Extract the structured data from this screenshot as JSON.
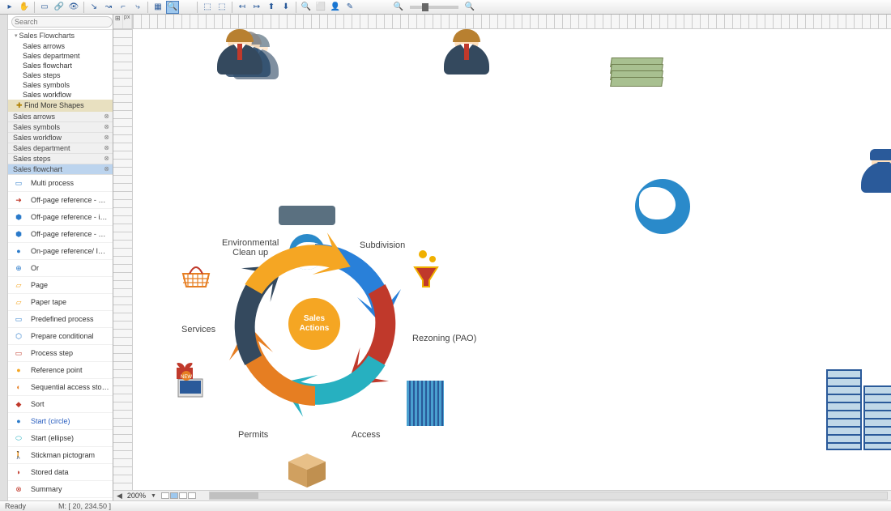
{
  "toolbar": {
    "search_placeholder": "Search"
  },
  "sidebar": {
    "tree_header": "Sales Flowcharts",
    "tree_items": [
      "Sales arrows",
      "Sales department",
      "Sales flowchart",
      "Sales steps",
      "Sales symbols",
      "Sales workflow"
    ],
    "find_more": "Find More Shapes",
    "libs": [
      "Sales arrows",
      "Sales symbols",
      "Sales workflow",
      "Sales department",
      "Sales steps",
      "Sales flowchart"
    ],
    "shapes": [
      {
        "label": "Multi process",
        "color": "#333"
      },
      {
        "label": "Off-page reference - arrow",
        "color": "#333"
      },
      {
        "label": "Off-page reference - incoming",
        "color": "#333"
      },
      {
        "label": "Off-page reference - outgoing",
        "color": "#333"
      },
      {
        "label": "On-page reference/ Inspe ...",
        "color": "#333"
      },
      {
        "label": "Or",
        "color": "#333"
      },
      {
        "label": "Page",
        "color": "#333"
      },
      {
        "label": "Paper tape",
        "color": "#333"
      },
      {
        "label": "Predefined process",
        "color": "#333"
      },
      {
        "label": "Prepare conditional",
        "color": "#333"
      },
      {
        "label": "Process step",
        "color": "#333"
      },
      {
        "label": "Reference point",
        "color": "#333"
      },
      {
        "label": "Sequential access storage",
        "color": "#333"
      },
      {
        "label": "Sort",
        "color": "#333"
      },
      {
        "label": "Start (circle)",
        "color": "#2a5fc0"
      },
      {
        "label": "Start (ellipse)",
        "color": "#333"
      },
      {
        "label": "Stickman pictogram",
        "color": "#333"
      },
      {
        "label": "Stored data",
        "color": "#333"
      },
      {
        "label": "Summary",
        "color": "#333"
      }
    ]
  },
  "canvas": {
    "diagram": {
      "center": "Sales\nActions",
      "labels": {
        "env": "Environmental\nClean up",
        "sub": "Subdivision",
        "rez": "Rezoning (PAO)",
        "acc": "Access",
        "per": "Permits",
        "ser": "Services"
      }
    }
  },
  "footer": {
    "zoom": "200%",
    "coords": "M: [ 20, 234.50 ]",
    "ready": "Ready"
  }
}
